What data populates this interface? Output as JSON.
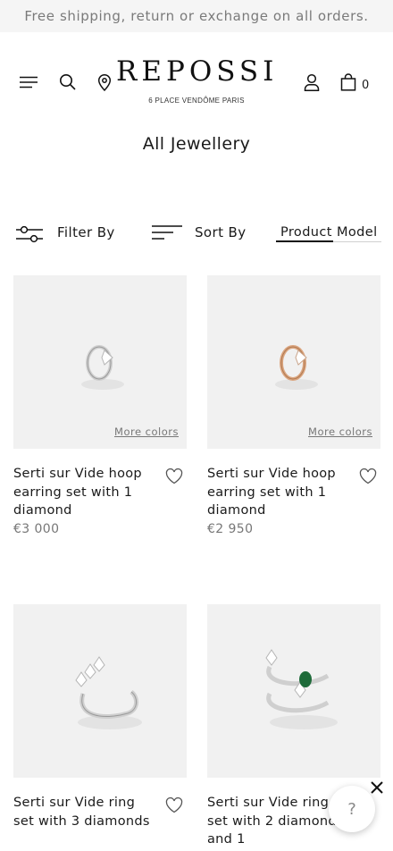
{
  "promo_bar": {
    "text": "Free shipping, return or exchange on all orders."
  },
  "header": {
    "brand": "REPOSSI",
    "brand_sub": "6 PLACE VENDÔME  PARIS",
    "cart_count": "0",
    "icons": [
      "menu-icon",
      "search-icon",
      "location-icon",
      "account-icon",
      "bag-icon"
    ]
  },
  "page": {
    "title": "All Jewellery"
  },
  "toolbar": {
    "filter_label": "Filter By",
    "sort_label": "Sort By",
    "view_toggle": {
      "options": [
        "Product",
        "Model"
      ],
      "active": "Product"
    }
  },
  "products": [
    {
      "name": "Serti sur Vide hoop earring set with 1 diamond",
      "price": "€3 000",
      "more_colors": "More colors",
      "metal_color": "#c9c9c9"
    },
    {
      "name": "Serti sur Vide hoop earring set with 1 diamond",
      "price": "€2 950",
      "more_colors": "More colors",
      "metal_color": "#d9a27a"
    },
    {
      "name": "Serti sur Vide ring set with 3 diamonds",
      "metal_color": "#cfcfcf"
    },
    {
      "name": "Serti sur Vide ring set with 2 diamonds and 1",
      "metal_color": "#cfcfcf",
      "stone_color": "#1f6b3a"
    }
  ],
  "help_button": {
    "label": "?"
  },
  "colors": {
    "accent": "#111111",
    "image_bg": "#f1f1f1",
    "muted_text": "#777777"
  }
}
